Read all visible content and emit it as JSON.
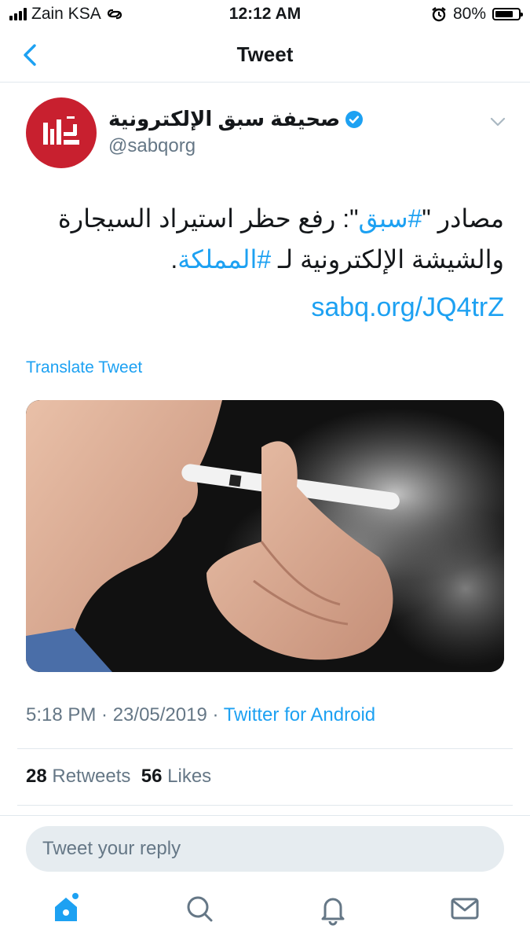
{
  "status_bar": {
    "carrier": "Zain KSA",
    "time": "12:12 AM",
    "battery_percent": "80%",
    "battery_level": 0.8
  },
  "nav": {
    "title": "Tweet"
  },
  "tweet": {
    "author_name": "صحيفة سبق الإلكترونية",
    "author_handle": "@sabqorg",
    "verified": true,
    "text_line1_prefix": "مصادر \"",
    "text_hashtag1": "#سبق",
    "text_line1_suffix": "\": رفع حظر استيراد السيجارة",
    "text_line2_prefix": "والشيشة الإلكترونية لـ ",
    "text_hashtag2": "#المملكة",
    "text_line2_suffix": ".",
    "url": "sabq.org/JQ4trZ",
    "translate_label": "Translate Tweet",
    "timestamp": "5:18 PM · 23/05/2019 · ",
    "source": "Twitter for Android",
    "retweets_count": "28",
    "retweets_label": " Retweets",
    "likes_count": "56",
    "likes_label": " Likes"
  },
  "reply": {
    "placeholder": "Tweet your reply"
  },
  "tabbar": {
    "items": [
      "home-icon",
      "search-icon",
      "notifications-icon",
      "messages-icon"
    ],
    "active": "home-icon"
  },
  "colors": {
    "accent": "#1da1f2",
    "avatar_bg": "#c8202f",
    "secondary_text": "#657786"
  }
}
